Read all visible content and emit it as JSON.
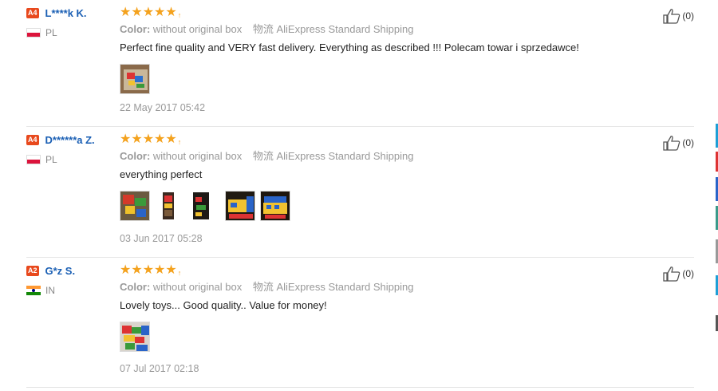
{
  "reviews": [
    {
      "level": "A4",
      "name": "L****k K.",
      "country": "PL",
      "stars": "★★★★★",
      "star_tail": "↑",
      "color_key": "Color:",
      "color_value": "without original box",
      "ship_key": "物流",
      "ship_value": "AliExpress Standard Shipping",
      "text": "Perfect fine quality and VERY fast delivery. Everything as described !!! Polecam towar i sprzedawce!",
      "photos": [
        "review-photo-lego-box"
      ],
      "date": "22 May 2017 05:42",
      "useful": "(0)"
    },
    {
      "level": "A4",
      "name": "D******a Z.",
      "country": "PL",
      "stars": "★★★★★",
      "star_tail": "↑",
      "color_key": "Color:",
      "color_value": "without original box",
      "ship_key": "物流",
      "ship_value": "AliExpress Standard Shipping",
      "text": "everything perfect",
      "photos": [
        "review-photo-build-1",
        "review-photo-build-2",
        "review-photo-build-3",
        "review-photo-build-4",
        "review-photo-build-5"
      ],
      "date": "03 Jun 2017 05:28",
      "useful": "(0)"
    },
    {
      "level": "A2",
      "name": "G*z S.",
      "country": "IN",
      "stars": "★★★★★",
      "star_tail": "↑",
      "color_key": "Color:",
      "color_value": "without original box",
      "ship_key": "物流",
      "ship_value": "AliExpress Standard Shipping",
      "text": "Lovely toys... Good quality.. Value for money!",
      "photos": [
        "review-photo-bricks"
      ],
      "date": "07 Jul 2017 02:18",
      "useful": "(0)"
    }
  ],
  "icons": {
    "like": "thumbs-up-icon"
  },
  "colors": {
    "level_badge": "#e8491d",
    "username": "#1a5fb4",
    "stars": "#f4a21e",
    "side_accent": "#1e9fd6"
  }
}
